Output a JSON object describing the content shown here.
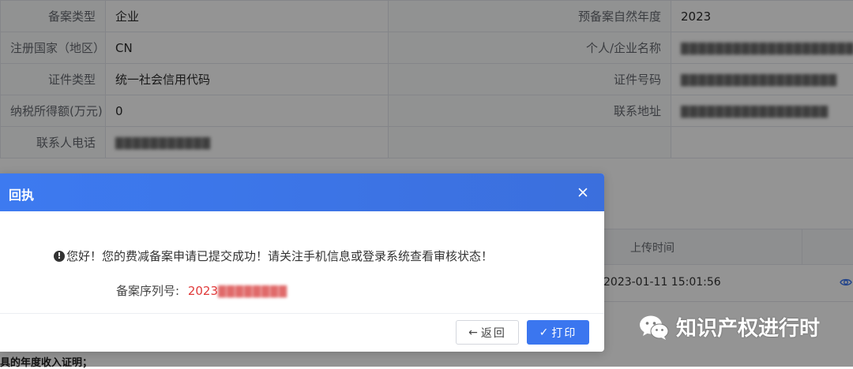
{
  "record_table": {
    "rows": [
      {
        "label1": "备案类型",
        "value1": "企业",
        "label2": "预备案自然年度",
        "value2": "2023"
      },
      {
        "label1": "注册国家（地区）",
        "value1": "CN",
        "label2": "个人/企业名称",
        "value2": "████████████████████"
      },
      {
        "label1": "证件类型",
        "value1": "统一社会信用代码",
        "label2": "证件号码",
        "value2": "██████████████████"
      },
      {
        "label1": "纳税所得额(万元)",
        "value1": "0",
        "label2": "联系地址",
        "value2": "█████████████████"
      },
      {
        "label1": "联系人电话",
        "value1": "███████████",
        "label2": "",
        "value2": ""
      }
    ]
  },
  "uploads": {
    "column_title": "上传时间",
    "rows": [
      {
        "time": "2023-01-11 15:01:56",
        "action_icon": "eye-icon"
      }
    ]
  },
  "bottom_note": "具的年度收入证明；",
  "dialog": {
    "title": "回执",
    "close_icon": "close-icon",
    "message": "您好！您的费减备案申请已提交成功！请关注手机信息或登录系统查看审核状态！",
    "message_icon": "info-circle-icon",
    "serial_label": "备案序列号:",
    "serial_value_prefix": "2023",
    "serial_value_masked": "████████",
    "back_label": "返回",
    "back_icon_glyph": "←",
    "print_label": "打印",
    "print_icon_glyph": "✓"
  },
  "watermark": {
    "text": "知识产权进行时",
    "icon": "wechat-icon"
  },
  "colors": {
    "dialog_header": "#3d7af0",
    "primary_button": "#3b76ef",
    "serial_red": "#e03a3a"
  }
}
